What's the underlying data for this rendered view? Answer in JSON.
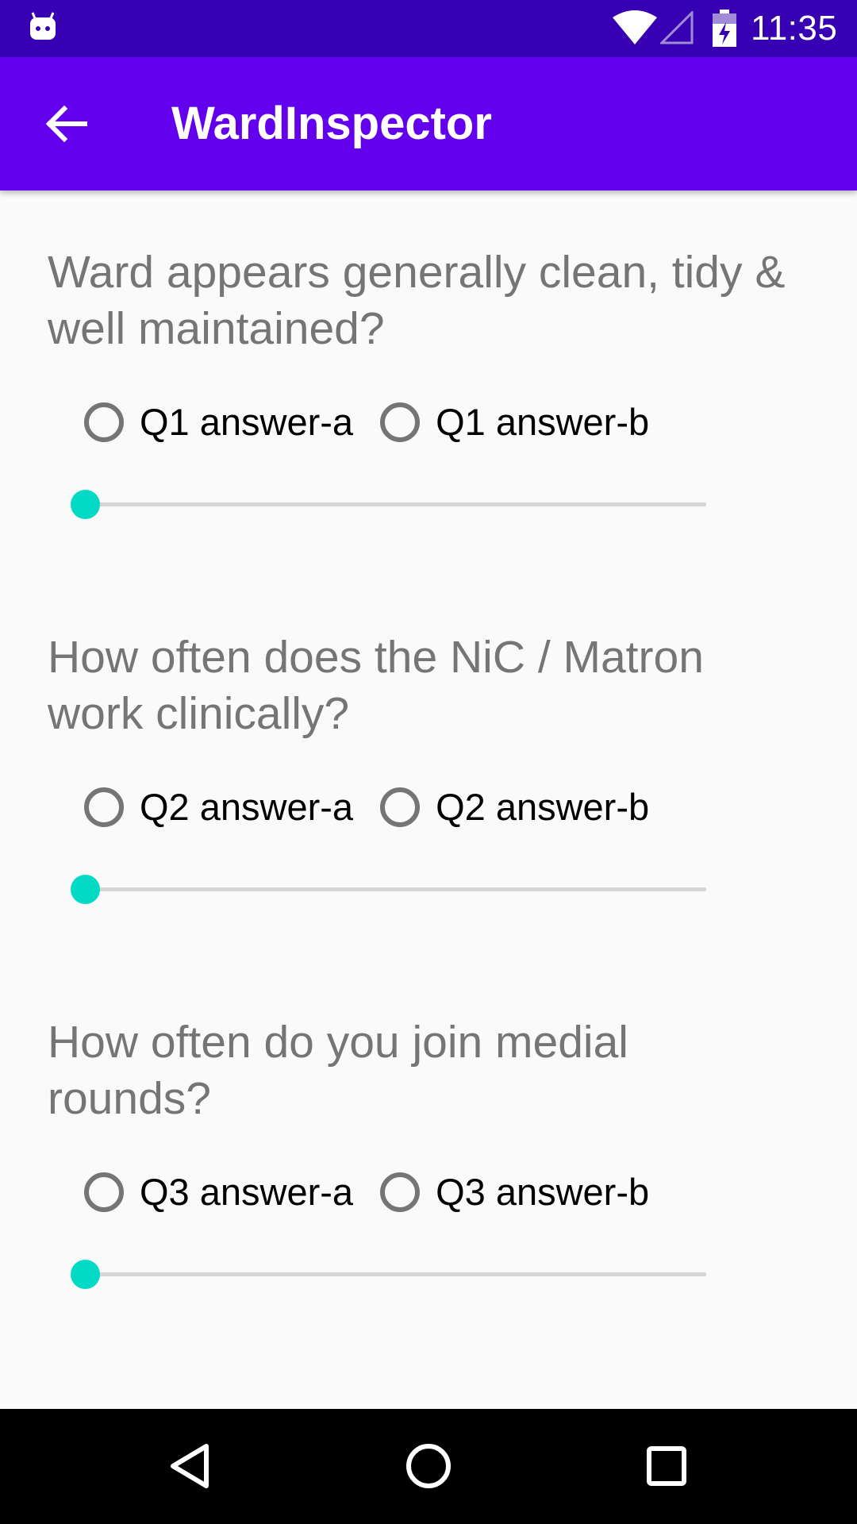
{
  "status_bar": {
    "time": "11:35",
    "icons": [
      "android-notification-icon",
      "wifi-icon",
      "cell-signal-icon",
      "battery-charging-icon"
    ]
  },
  "app_bar": {
    "title": "WardInspector",
    "back_icon": "arrow-back-icon"
  },
  "questions": [
    {
      "text": "Ward appears generally clean, tidy & well maintained?",
      "options": [
        "Q1 answer-a",
        "Q1 answer-b"
      ],
      "selected": null,
      "slider_value": 0
    },
    {
      "text": "How often does the NiC / Matron work clinically?",
      "options": [
        "Q2 answer-a",
        "Q2 answer-b"
      ],
      "selected": null,
      "slider_value": 0
    },
    {
      "text": "How often do you join medial rounds?",
      "options": [
        "Q3 answer-a",
        "Q3 answer-b"
      ],
      "selected": null,
      "slider_value": 0
    }
  ],
  "nav_bar": {
    "icons": [
      "back-triangle-icon",
      "home-circle-icon",
      "recents-square-icon"
    ]
  },
  "colors": {
    "status_bar": "#3700b3",
    "app_bar": "#6200ee",
    "accent": "#03dac5",
    "question_text": "#757575",
    "background": "#fafafa"
  }
}
